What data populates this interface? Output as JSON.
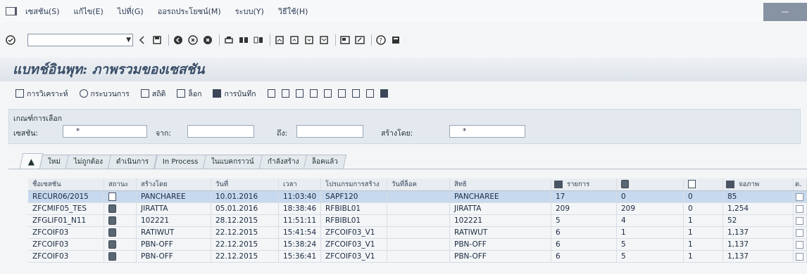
{
  "menu": {
    "items": [
      "เซสชัน(S)",
      "แก้ไข(E)",
      "ไปที่(G)",
      "ออรถประโยชน์(M)",
      "ระบบ(Y)",
      "วิธีใช้(H)"
    ]
  },
  "window": {
    "control_label": "—"
  },
  "toolbar": {
    "command_placeholder": ""
  },
  "page": {
    "title": "แบทช์อินพุท: ภาพรวมของเซสชัน"
  },
  "appbar": {
    "buttons": [
      "การวิเคราะห์",
      "กระบวนการ",
      "สถิติ",
      "ล็อก",
      "การบันทึก"
    ]
  },
  "selection": {
    "header": "เกณฑ์การเลือก",
    "session_label": "เซสชัน:",
    "session_value": "*",
    "from_label": "จาก:",
    "from_value": "",
    "to_label": "ถึง:",
    "to_value": "",
    "created_by_label": "สร้างโดย:",
    "created_by_value": "*"
  },
  "tabs": [
    "ใหม่",
    "ไม่ถูกต้อง",
    "ดำเนินการ",
    "In Process",
    "ในแบคกราวน์",
    "กำลังสร้าง",
    "ล็อคแล้ว"
  ],
  "grid": {
    "headers": [
      "ชื่อเซสชัน",
      "สถานะ",
      "สร้างโดย",
      "วันที่",
      "เวลา",
      "โปรแกรมการสร้าง",
      "วันที่ล็อค",
      "สิทธิ",
      "รายการ",
      "",
      "",
      "จอภาพ",
      "ด."
    ],
    "rows": [
      {
        "name": "RECUR06/2015",
        "status": "new",
        "created_by": "PANCHAREE",
        "date": "10.01.2016",
        "time": "11:03:40",
        "program": "SAPF120",
        "lock_date": "",
        "auth": "PANCHAREE",
        "items": "17",
        "c1": "0",
        "c2": "0",
        "screens": "85"
      },
      {
        "name": "ZFCMIF05_TES",
        "status": "error",
        "created_by": "JIRATTA",
        "date": "05.01.2016",
        "time": "18:38:46",
        "program": "RFBIBL01",
        "lock_date": "",
        "auth": "JIRATTA",
        "items": "209",
        "c1": "209",
        "c2": "0",
        "screens": "1,254"
      },
      {
        "name": "ZFGLIF01_N11",
        "status": "error",
        "created_by": "102221",
        "date": "28.12.2015",
        "time": "11:51:11",
        "program": "RFBIBL01",
        "lock_date": "",
        "auth": "102221",
        "items": "5",
        "c1": "4",
        "c2": "1",
        "screens": "52"
      },
      {
        "name": "ZFCOIF03",
        "status": "error",
        "created_by": "RATIWUT",
        "date": "22.12.2015",
        "time": "15:41:54",
        "program": "ZFCOIF03_V1",
        "lock_date": "",
        "auth": "RATIWUT",
        "items": "6",
        "c1": "1",
        "c2": "1",
        "screens": "1,137"
      },
      {
        "name": "ZFCOIF03",
        "status": "error",
        "created_by": "PBN-OFF",
        "date": "22.12.2015",
        "time": "15:38:24",
        "program": "ZFCOIF03_V1",
        "lock_date": "",
        "auth": "PBN-OFF",
        "items": "6",
        "c1": "5",
        "c2": "1",
        "screens": "1,137"
      },
      {
        "name": "ZFCOIF03",
        "status": "error",
        "created_by": "PBN-OFF",
        "date": "22.12.2015",
        "time": "15:36:41",
        "program": "ZFCOIF03_V1",
        "lock_date": "",
        "auth": "PBN-OFF",
        "items": "6",
        "c1": "5",
        "c2": "1",
        "screens": "1,137"
      }
    ]
  }
}
